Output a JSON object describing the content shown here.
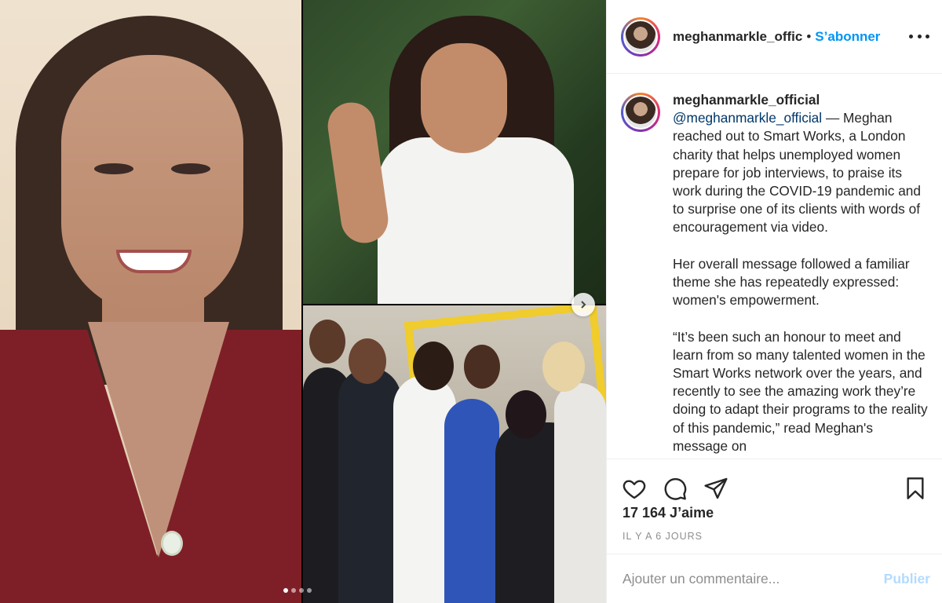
{
  "post": {
    "username": "meghanmarkle_offic",
    "full_username": "meghanmarkle_official",
    "separator": "•",
    "follow_label": "S’abonner",
    "more_icon": "more-horizontal-icon"
  },
  "caption": {
    "username": "meghanmarkle_official",
    "mention": "@meghanmarkle_official",
    "para1_rest": " — Meghan reached out to Smart Works, a London charity that helps unemployed women prepare for job interviews, to praise its work during the COVID-19 pandemic and to surprise one of its clients with words of encouragement via video.",
    "para2": "Her overall message followed a familiar theme she has repeatedly expressed: women's empowerment.",
    "para3": "“It’s been such an honour to meet and learn from so many talented women in the Smart Works network over the years, and recently to see the amazing work they’re doing to adapt their programs to the reality of this pandemic,” read Meghan's message on"
  },
  "actions": {
    "like_icon": "heart-icon",
    "comment_icon": "comment-icon",
    "share_icon": "share-icon",
    "save_icon": "bookmark-icon",
    "likes": "17 164 J’aime",
    "time_ago": "IL Y A 6 JOURS"
  },
  "comment": {
    "placeholder": "Ajouter un commentaire...",
    "publish_label": "Publier"
  },
  "carousel": {
    "slide_count": 4,
    "active_index": 0,
    "next_icon": "chevron-right-icon"
  },
  "colors": {
    "accent": "#0095f6",
    "publish_disabled": "#b3dbff",
    "muted": "#8e8e8e",
    "mention": "#00376b"
  }
}
